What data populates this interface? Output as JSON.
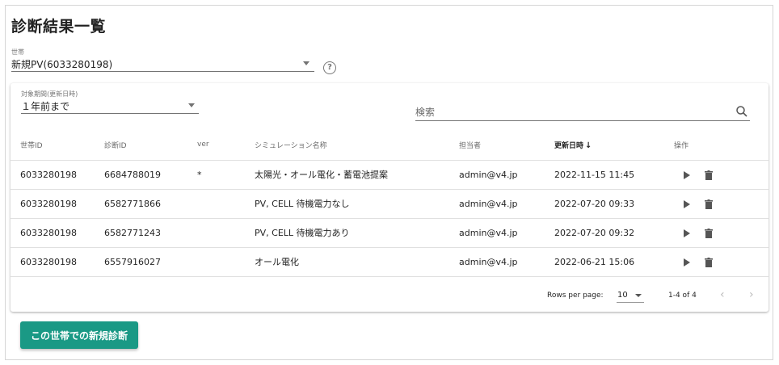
{
  "page": {
    "title": "診断結果一覧"
  },
  "household": {
    "label": "世帯",
    "value": "新規PV(6033280198)"
  },
  "period": {
    "label": "対象期間(更新日時)",
    "value": "１年前まで"
  },
  "search": {
    "placeholder": "検索"
  },
  "table": {
    "headers": [
      "世帯ID",
      "診断ID",
      "ver",
      "シミュレーション名称",
      "担当者",
      "更新日時",
      "操作"
    ],
    "sort_column": "更新日時",
    "sort_direction": "descending",
    "rows": [
      {
        "household_id": "6033280198",
        "diagnosis_id": "6684788019",
        "ver": "*",
        "name": "太陽光・オール電化・蓄電池提案",
        "owner": "admin@v4.jp",
        "updated": "2022-11-15 11:45"
      },
      {
        "household_id": "6033280198",
        "diagnosis_id": "6582771866",
        "ver": "",
        "name": "PV, CELL 待機電力なし",
        "owner": "admin@v4.jp",
        "updated": "2022-07-20 09:33"
      },
      {
        "household_id": "6033280198",
        "diagnosis_id": "6582771243",
        "ver": "",
        "name": "PV, CELL 待機電力あり",
        "owner": "admin@v4.jp",
        "updated": "2022-07-20 09:32"
      },
      {
        "household_id": "6033280198",
        "diagnosis_id": "6557916027",
        "ver": "",
        "name": "オール電化",
        "owner": "admin@v4.jp",
        "updated": "2022-06-21 15:06"
      }
    ],
    "row_actions": [
      "play-icon",
      "trash-icon"
    ]
  },
  "pagination": {
    "rows_per_page_label": "Rows per page:",
    "rows_per_page": "10",
    "range": "1-4 of 4"
  },
  "actions": {
    "new_label": "この世帯での新規診断"
  },
  "colors": {
    "accent": "#1a9985"
  }
}
